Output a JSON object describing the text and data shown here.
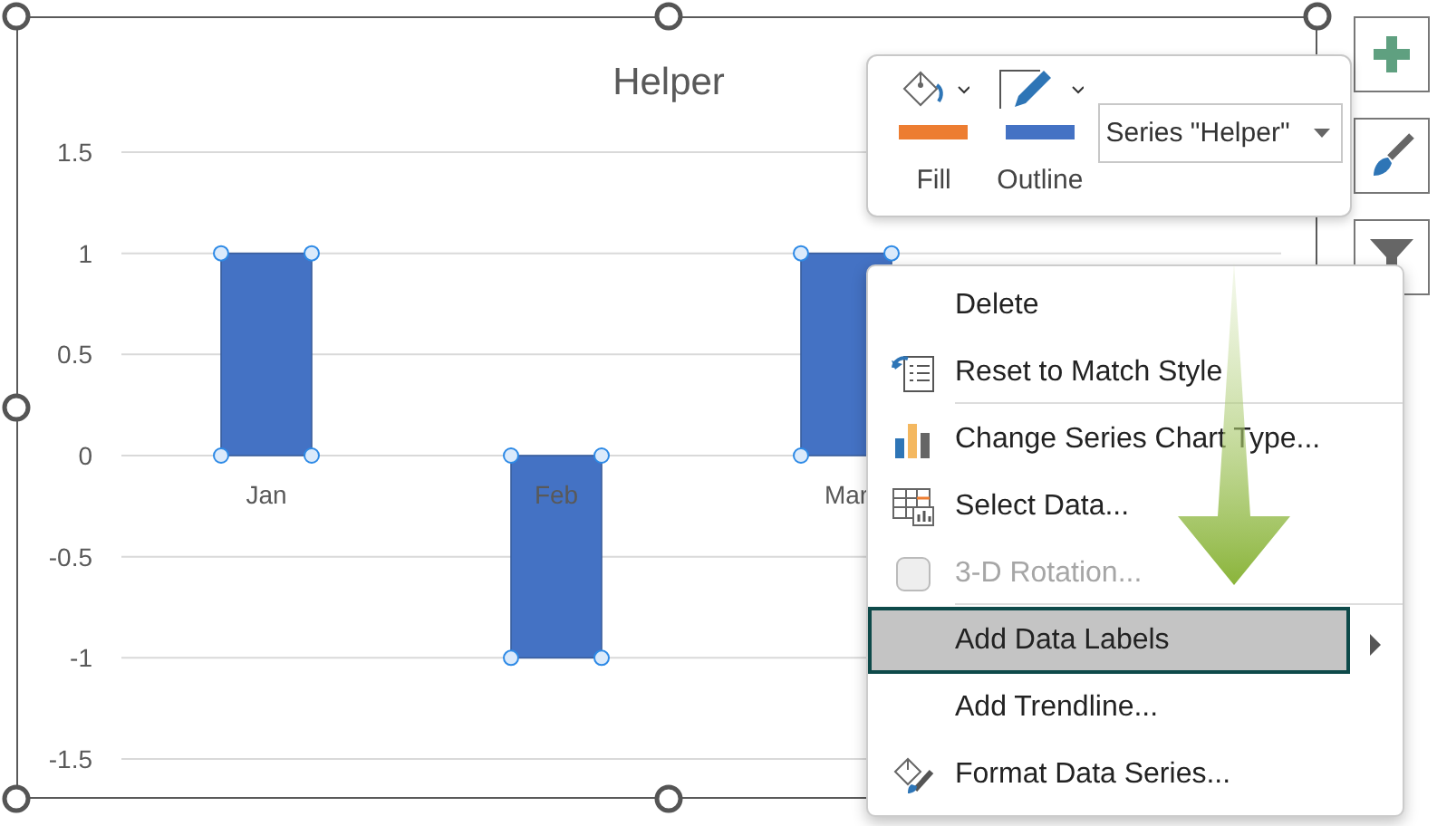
{
  "chart": {
    "chart_data": {
      "type": "bar",
      "title": "Helper",
      "categories": [
        "Jan",
        "Feb",
        "Mar"
      ],
      "series": [
        {
          "color": "#4472c4",
          "values": [
            1,
            -1,
            1
          ]
        }
      ],
      "ylim": [
        -1.5,
        1.5
      ],
      "grid": true,
      "yticks": [
        1.5,
        1,
        0.5,
        0,
        -0.5,
        -1,
        -1.5
      ]
    },
    "selected": true
  },
  "mini_toolbar": {
    "buttons": [
      {
        "label": "Fill",
        "kind": "fill",
        "color": "#ed7d31"
      },
      {
        "label": "Outline",
        "kind": "outline",
        "color": "#4472c4"
      }
    ],
    "series_select": {
      "value": "Series \"Helper\""
    }
  },
  "context_menu": {
    "items": [
      {
        "label": "Delete",
        "kind": "delete",
        "disabled": false,
        "selected": false,
        "submenu": false,
        "separator_after": false
      },
      {
        "label": "Reset to Match Style",
        "kind": "reset",
        "disabled": false,
        "selected": false,
        "submenu": false,
        "separator_after": true
      },
      {
        "label": "Change Series Chart Type...",
        "kind": "charttype",
        "disabled": false,
        "selected": false,
        "submenu": false,
        "separator_after": false
      },
      {
        "label": "Select Data...",
        "kind": "selectdata",
        "disabled": false,
        "selected": false,
        "submenu": false,
        "separator_after": false
      },
      {
        "label": "3-D Rotation...",
        "kind": "rotation",
        "disabled": true,
        "selected": false,
        "submenu": false,
        "separator_after": true
      },
      {
        "label": "Add Data Labels",
        "kind": "labels",
        "disabled": false,
        "selected": true,
        "submenu": true,
        "separator_after": false
      },
      {
        "label": "Add Trendline...",
        "kind": "trendline",
        "disabled": false,
        "selected": false,
        "submenu": false,
        "separator_after": false
      },
      {
        "label": "Format Data Series...",
        "kind": "format",
        "disabled": false,
        "selected": false,
        "submenu": false,
        "separator_after": false
      }
    ]
  }
}
